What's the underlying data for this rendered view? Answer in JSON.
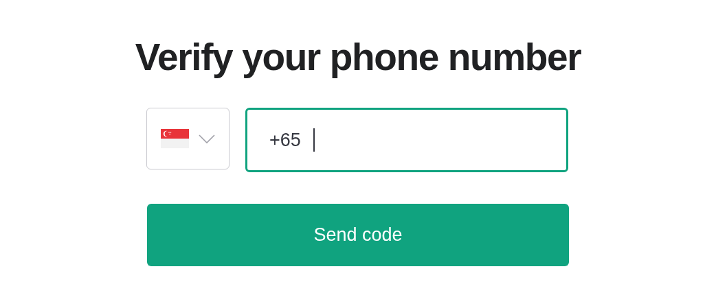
{
  "title": "Verify your phone number",
  "country_select": {
    "expanded": false
  },
  "phone_field": {
    "value": "+65",
    "focused": true
  },
  "submit_button": {
    "label": "Send code"
  }
}
